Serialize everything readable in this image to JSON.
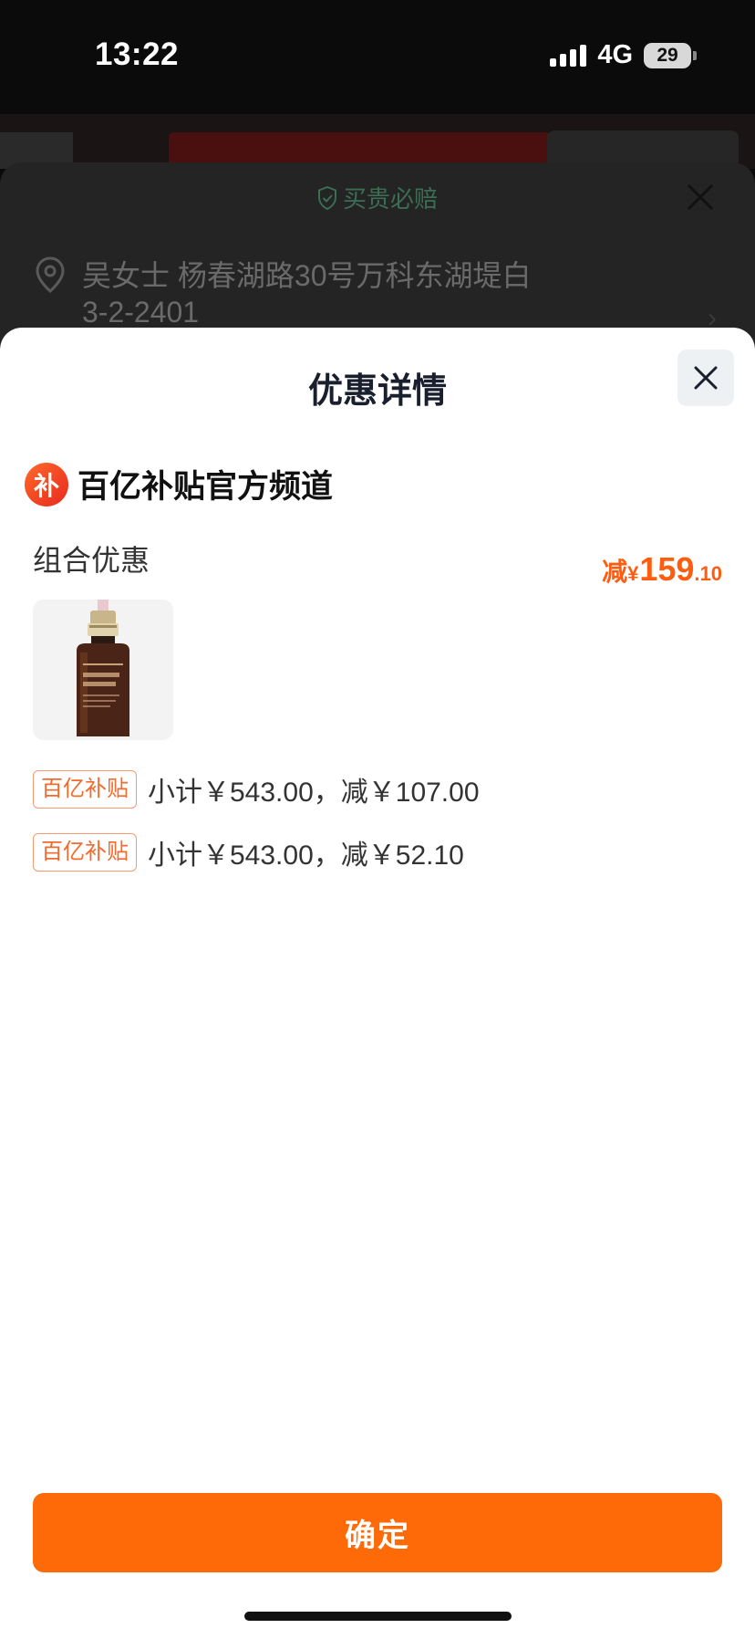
{
  "status": {
    "time": "13:22",
    "network": "4G",
    "battery": "29"
  },
  "background": {
    "guarantee": "买贵必赔",
    "address_line1": "吴女士 杨春湖路30号万科东湖堤白",
    "address_line2": "3-2-2401"
  },
  "sheet": {
    "title": "优惠详情",
    "channel": {
      "logo_char": "补",
      "name": "百亿补贴官方频道"
    },
    "combo_label": "组合优惠",
    "discount": {
      "prefix": "减",
      "currency": "¥",
      "integer": "159",
      "decimal": ".10"
    },
    "rows": [
      {
        "tag": "百亿补贴",
        "text": "小计￥543.00，减￥107.00"
      },
      {
        "tag": "百亿补贴",
        "text": "小计￥543.00，减￥52.10"
      }
    ],
    "confirm": "确定"
  },
  "colors": {
    "accent": "#fe6a08",
    "discount": "#fe5d10"
  },
  "icons": [
    "close-icon",
    "shield-icon",
    "location-pin-icon",
    "chevron-right-icon",
    "signal-icon",
    "battery-icon"
  ]
}
